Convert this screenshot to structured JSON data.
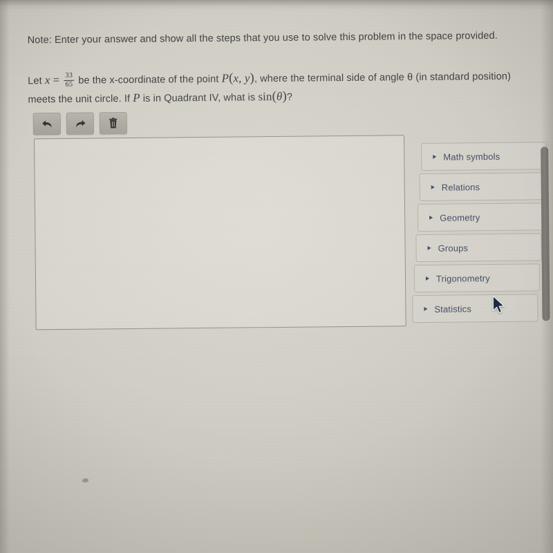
{
  "question": {
    "note_label": "Note:",
    "note_text": "Note: Enter your answer and show all the steps that you use to solve this problem in the space provided.",
    "prompt_part_1": "Let",
    "math_x": "x",
    "math_equals": "=",
    "fraction_numerator": "33",
    "fraction_denominator": "65",
    "prompt_part_2": "be the x-coordinate of the point",
    "math_point": "P",
    "math_point_args": "x, y",
    "prompt_part_3": ", where the terminal side of angle",
    "math_theta": "θ",
    "prompt_part_4": "(in standard position) meets the unit circle. If",
    "math_p": "P",
    "prompt_part_5": "is in Quadrant IV, what is",
    "math_sin": "sin",
    "math_sin_arg": "θ",
    "prompt_end": "?"
  },
  "toolbar": {
    "undo_label": "Undo",
    "undo_icon": "undo-arrow-icon",
    "redo_label": "Redo",
    "redo_icon": "redo-arrow-icon",
    "delete_label": "Delete",
    "delete_icon": "trash-can-icon"
  },
  "answer_area": {
    "value": "",
    "placeholder": ""
  },
  "symbol_panel": {
    "items": [
      {
        "label": "Math symbols",
        "caret": "caret-right-icon",
        "expanded": false
      },
      {
        "label": "Relations",
        "caret": "caret-right-icon",
        "expanded": false
      },
      {
        "label": "Geometry",
        "caret": "caret-right-icon",
        "expanded": false
      },
      {
        "label": "Groups",
        "caret": "caret-right-icon",
        "expanded": false
      },
      {
        "label": "Trigonometry",
        "caret": "caret-right-icon",
        "expanded": false
      },
      {
        "label": "Statistics",
        "caret": "caret-right-icon",
        "expanded": false
      }
    ]
  },
  "scrollbar": {
    "orientation": "vertical"
  },
  "colors": {
    "text": "#3c3c3e",
    "panel_text": "#3d4a60",
    "caret": "#3b4a63",
    "border": "#8f8d86",
    "button_face": "#aeaba3",
    "scrollbar_thumb": "#6e6c67",
    "background": "#d2cfc6"
  }
}
